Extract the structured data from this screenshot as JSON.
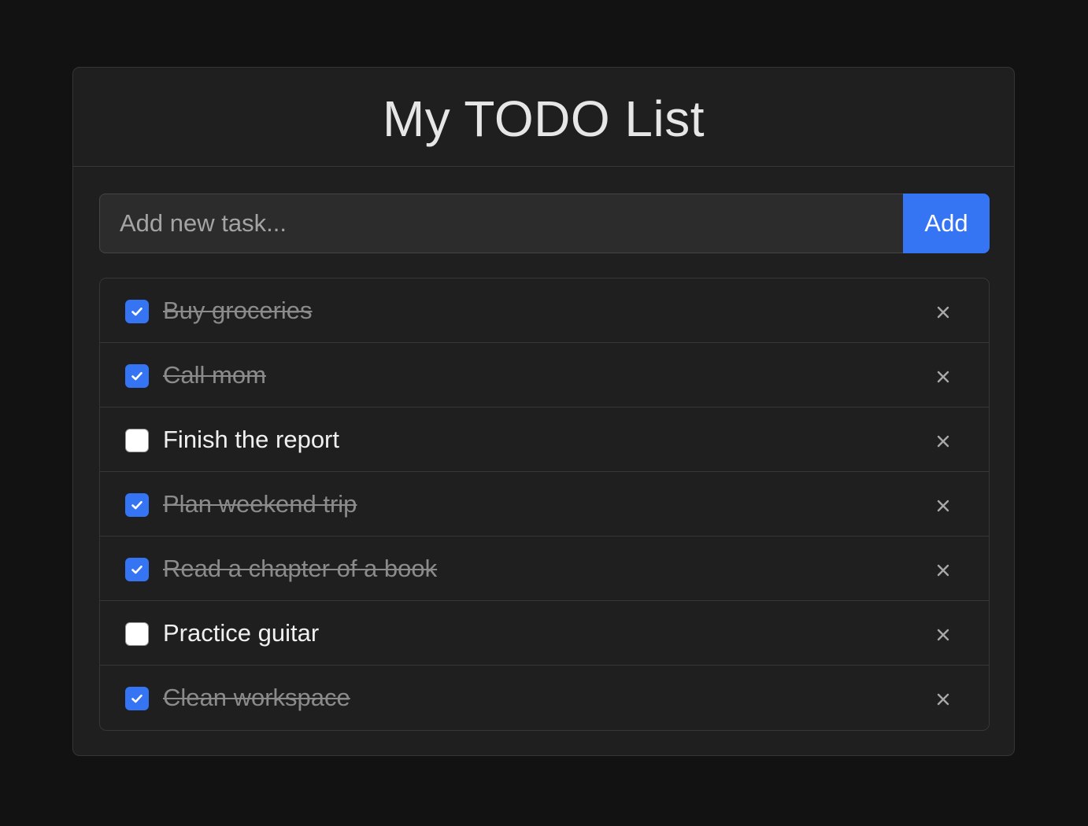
{
  "app": {
    "title": "My TODO List"
  },
  "add_task": {
    "placeholder": "Add new task...",
    "value": "",
    "button_label": "Add"
  },
  "tasks": [
    {
      "label": "Buy groceries",
      "completed": true
    },
    {
      "label": "Call mom",
      "completed": true
    },
    {
      "label": "Finish the report",
      "completed": false
    },
    {
      "label": "Plan weekend trip",
      "completed": true
    },
    {
      "label": "Read a chapter of a book",
      "completed": true
    },
    {
      "label": "Practice guitar",
      "completed": false
    },
    {
      "label": "Clean workspace",
      "completed": true
    }
  ],
  "icons": {
    "checkbox_checked": "check-icon",
    "delete": "close-icon"
  },
  "colors": {
    "background": "#121212",
    "card": "#1f1f1f",
    "accent": "#3575f3",
    "text": "#e6e6e6",
    "completed_text": "#8b8b8b",
    "border": "#363636"
  }
}
